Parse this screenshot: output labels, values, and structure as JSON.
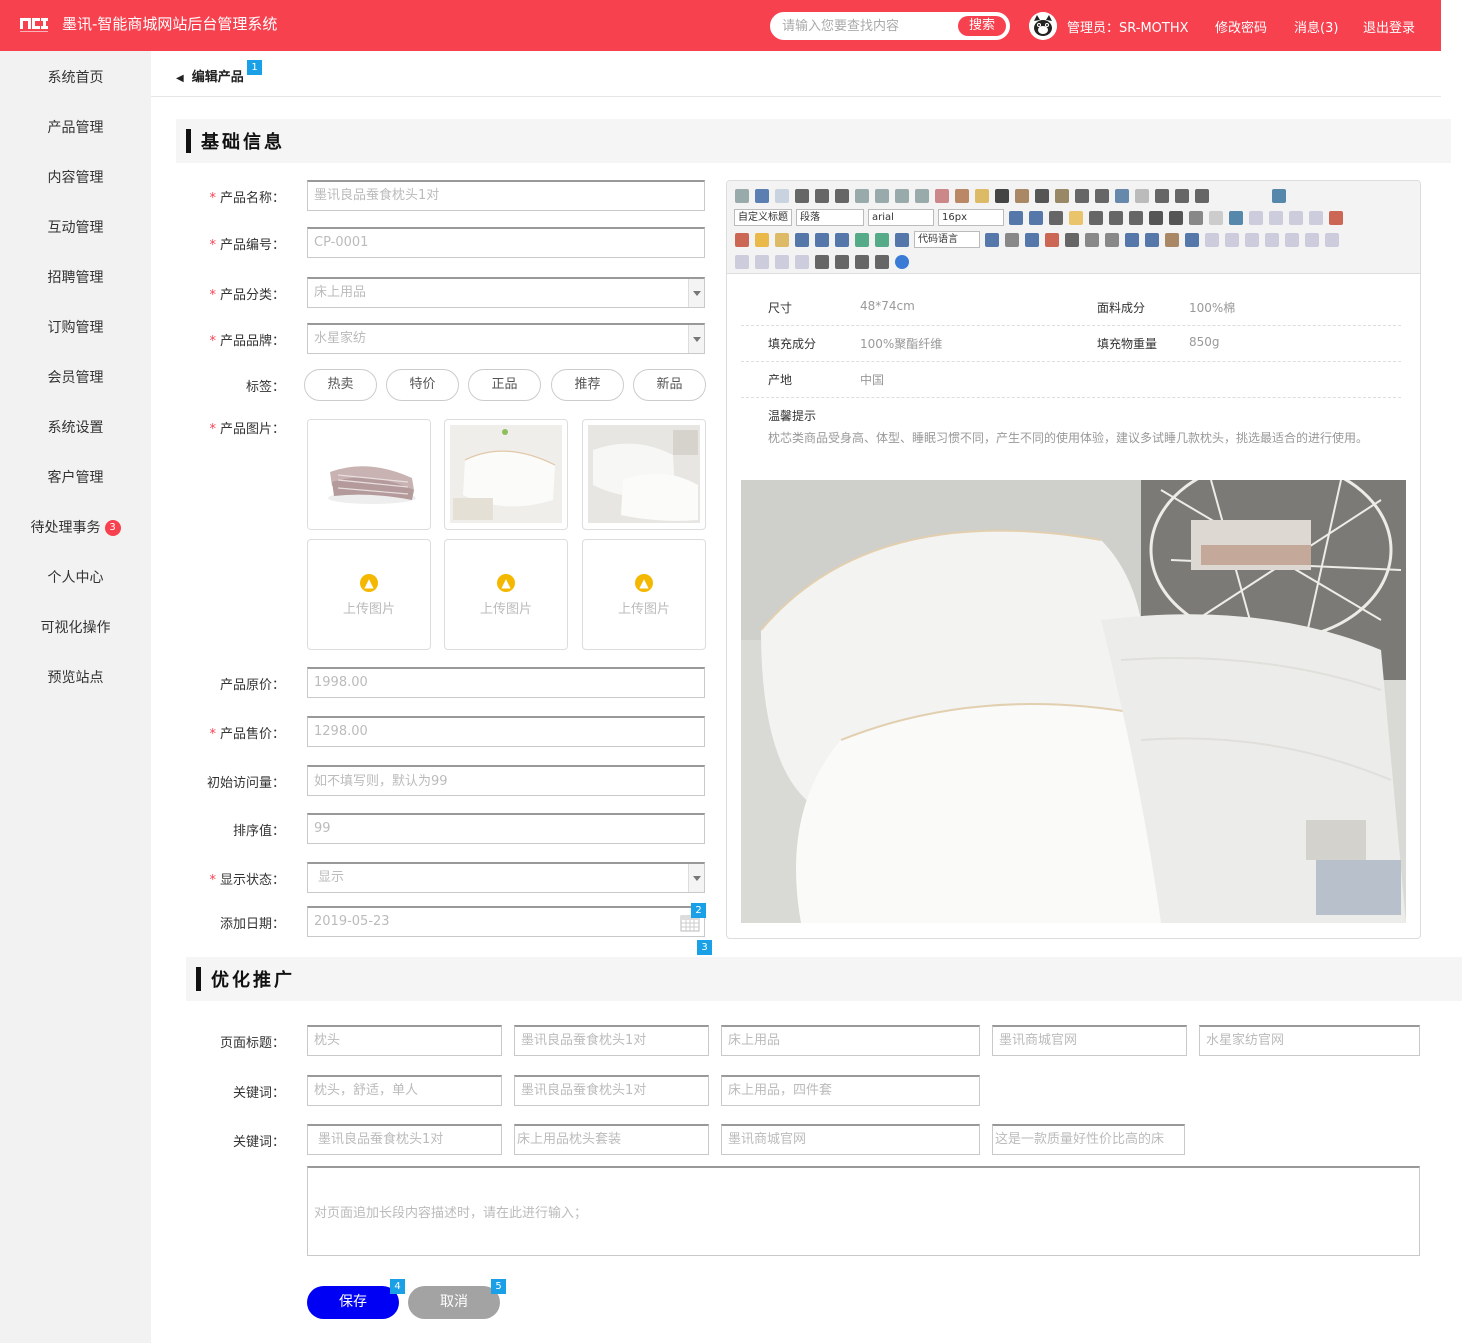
{
  "header": {
    "title": "墨讯-智能商城网站后台管理系统",
    "search_placeholder": "请输入您要查找内容",
    "search_button": "搜索",
    "admin": "管理员：SR-MOTHX",
    "change_password": "修改密码",
    "messages": "消息(3)",
    "logout": "退出登录",
    "brand_color": "#f8414f"
  },
  "sidebar": {
    "items": [
      {
        "label": "系统首页"
      },
      {
        "label": "产品管理"
      },
      {
        "label": "内容管理"
      },
      {
        "label": "互动管理"
      },
      {
        "label": "招聘管理"
      },
      {
        "label": "订购管理"
      },
      {
        "label": "会员管理"
      },
      {
        "label": "系统设置"
      },
      {
        "label": "客户管理"
      },
      {
        "label": "待处理事务",
        "badge": "3"
      },
      {
        "label": "个人中心"
      },
      {
        "label": "可视化操作"
      },
      {
        "label": "预览站点"
      }
    ]
  },
  "breadcrumb": "编辑产品",
  "markers": [
    "1",
    "2",
    "3",
    "4",
    "5"
  ],
  "basic": {
    "title": "基础信息",
    "labels": {
      "name": "产品名称：",
      "code": "产品编号：",
      "category": "产品分类：",
      "brand": "产品品牌：",
      "tags": "标签：",
      "images": "产品图片：",
      "orig_price": "产品原价：",
      "sale_price": "产品售价：",
      "visits": "初始访问量：",
      "sort": "排序值：",
      "status": "显示状态：",
      "date": "添加日期："
    },
    "name": "墨讯良品蚕食枕头1对",
    "code": "CP-0001",
    "category": "床上用品",
    "brand": "水星家纺",
    "tags": [
      "热卖",
      "特价",
      "正品",
      "推荐",
      "新品"
    ],
    "upload_label": "上传图片",
    "orig_price": "1998.00",
    "sale_price": "1298.00",
    "visits_placeholder": "如不填写则，默认为99",
    "sort": "99",
    "status": "显示",
    "date": "2019-05-23"
  },
  "editor": {
    "heading_select": "自定义标题",
    "paragraph_select": "段落",
    "font_select": "arial",
    "size_select": "16px",
    "code_select": "代码语言",
    "specs": [
      {
        "label": "尺寸",
        "value": "48*74cm"
      },
      {
        "label": "面料成分",
        "value": "100%棉"
      },
      {
        "label": "填充成分",
        "value": "100%聚酯纤维"
      },
      {
        "label": "填充物重量",
        "value": "850g"
      },
      {
        "label": "产地",
        "value": "中国"
      }
    ],
    "tip_title": "温馨提示",
    "tip_text": "枕芯类商品受身高、体型、睡眠习惯不同，产生不同的使用体验，建议多试睡几款枕头，挑选最适合的进行使用。"
  },
  "seo": {
    "title": "优化推广",
    "page_title_label": "页面标题：",
    "keywords_label": "关键词：",
    "page_titles": [
      "枕头",
      "墨讯良品蚕食枕头1对",
      "床上用品",
      "墨讯商城官网",
      "水星家纺官网"
    ],
    "keywords1": [
      "枕头，舒适，单人",
      "墨讯良品蚕食枕头1对",
      "床上用品，四件套"
    ],
    "keywords2": [
      "墨讯良品蚕食枕头1对",
      "床上用品枕头套装",
      "墨讯商城官网",
      "这是一款质量好性价比高的床"
    ],
    "description_placeholder": "对页面追加长段内容描述时，请在此进行输入；"
  },
  "actions": {
    "save": "保存",
    "cancel": "取消"
  }
}
